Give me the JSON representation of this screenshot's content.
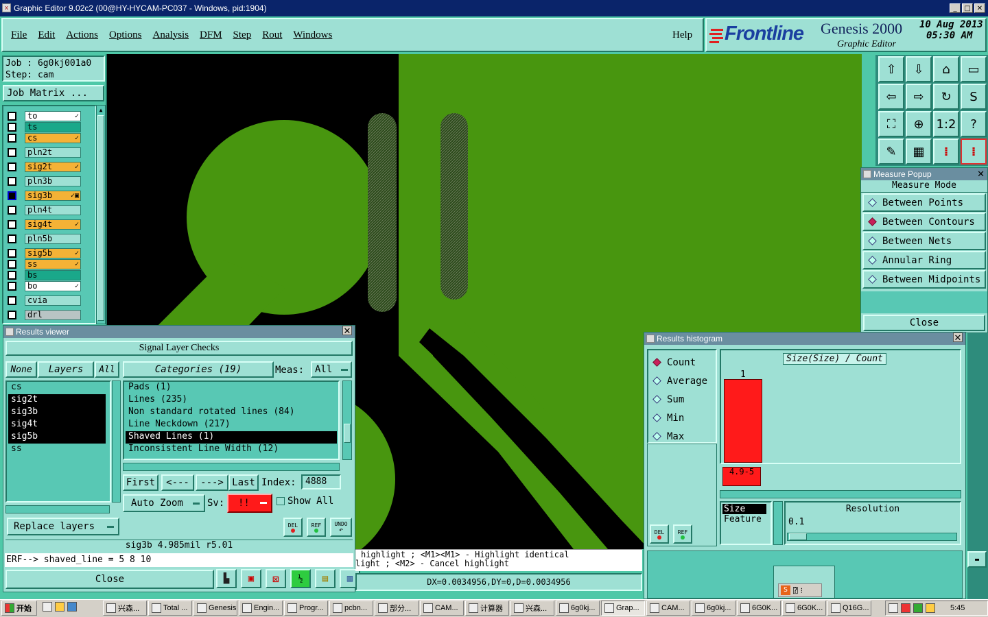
{
  "window": {
    "title": "Graphic Editor 9.02c2 (00@HY-HYCAM-PC037 - Windows, pid:1904)"
  },
  "menu": [
    "File",
    "Edit",
    "Actions",
    "Options",
    "Analysis",
    "DFM",
    "Step",
    "Rout",
    "Windows"
  ],
  "help": "Help",
  "brand": {
    "logo": "Frontline",
    "product": "Genesis 2000",
    "subtitle": "Graphic Editor",
    "date": "10 Aug 2013",
    "time": "05:30 AM"
  },
  "job": {
    "job_label": "Job : 6g0kj001a0",
    "step_label": "Step: cam",
    "matrix_button": "Job Matrix ..."
  },
  "layers": [
    {
      "name": "to",
      "color": "#ffffff",
      "mark": "✓"
    },
    {
      "name": "ts",
      "color": "#1aa88a",
      "mark": ""
    },
    {
      "name": "cs",
      "color": "#f4b236",
      "mark": "✓"
    },
    {
      "name": "pln2t",
      "color": "#9ee0d4",
      "mark": ""
    },
    {
      "name": "sig2t",
      "color": "#f4b236",
      "mark": "✓"
    },
    {
      "name": "pln3b",
      "color": "#9ee0d4",
      "mark": ""
    },
    {
      "name": "sig3b",
      "color": "#f4b236",
      "mark": "✓▣"
    },
    {
      "name": "pln4t",
      "color": "#9ee0d4",
      "mark": ""
    },
    {
      "name": "sig4t",
      "color": "#f4b236",
      "mark": "✓"
    },
    {
      "name": "pln5b",
      "color": "#9ee0d4",
      "mark": ""
    },
    {
      "name": "sig5b",
      "color": "#f4b236",
      "mark": "✓"
    },
    {
      "name": "ss",
      "color": "#f4b236",
      "mark": "✓"
    },
    {
      "name": "bs",
      "color": "#1aa88a",
      "mark": ""
    },
    {
      "name": "bo",
      "color": "#ffffff",
      "mark": "✓"
    },
    {
      "name": "cvia",
      "color": "#9ee0d4",
      "mark": ""
    },
    {
      "name": "drl",
      "color": "#b9c4c4",
      "mark": ""
    }
  ],
  "results_viewer": {
    "title": "Results viewer",
    "header": "Signal Layer Checks",
    "none_btn": "None",
    "layers_btn": "Layers",
    "all_btn": "All",
    "layer_list": [
      "cs",
      "sig2t",
      "sig3b",
      "sig4t",
      "sig5b",
      "ss"
    ],
    "selected_layers": [
      1,
      2,
      3,
      4
    ],
    "categories_btn": "Categories (19)",
    "meas_label": "Meas:",
    "meas_value": "All",
    "categories": [
      "Pads (1)",
      "Lines (235)",
      "Non standard rotated lines (84)",
      "Line Neckdown (217)",
      "Shaved Lines (1)",
      "Inconsistent Line Width (12)"
    ],
    "selected_category": 4,
    "first": "First",
    "prev": "<---",
    "next": "--->",
    "last": "Last",
    "index_label": "Index:",
    "index_value": "4888",
    "auto_zoom": "Auto Zoom",
    "sv_label": "Sv:",
    "sv_value": "!!",
    "show_all": "Show All",
    "replace_layers": "Replace layers",
    "del": "DEL",
    "ref": "REF",
    "undo": "UNDO",
    "status": "sig3b 4.985mil   r5.01",
    "erf": "ERF--> shaved_line = 5 8 10",
    "close": "Close"
  },
  "measure_popup": {
    "title": "Measure Popup",
    "mode_label": "Measure Mode",
    "options": [
      "Between Points",
      "Between Contours",
      "Between Nets",
      "Annular Ring",
      "Between Midpoints"
    ],
    "selected": 1,
    "close": "Close"
  },
  "histogram": {
    "title": "Results histogram",
    "options": [
      "Count",
      "Average",
      "Sum",
      "Min",
      "Max"
    ],
    "selected": 0,
    "chart_title": "Size(Size) / Count",
    "bar_label": "1",
    "bin_label": "4.9-5",
    "size_item": "Size",
    "feature_item": "Feature",
    "resolution_label": "Resolution",
    "resolution_value": "0.1",
    "del": "DEL",
    "ref": "REF"
  },
  "hints": {
    "line1": "highlight ; <M1><M1> - Highlight identical",
    "line2": "light ; <M2> - Cancel highlight",
    "coords": "DX=0.0034956,DY=0,D=0.0034956"
  },
  "taskbar": {
    "start": "开始",
    "items": [
      "兴森...",
      "Total ...",
      "Genesis",
      "Engin...",
      "Progr...",
      "pcbn...",
      "部分...",
      "CAM...",
      "计算器",
      "兴森...",
      "6g0kj...",
      "Grap...",
      "CAM...",
      "6g0kj...",
      "6G0K...",
      "6G0K...",
      "Q16G..."
    ],
    "clock": "5:45"
  },
  "colors": {
    "accent_green": "#3f8f12",
    "pad_green": "#48960f",
    "highlight_red": "#ff1a1a"
  }
}
